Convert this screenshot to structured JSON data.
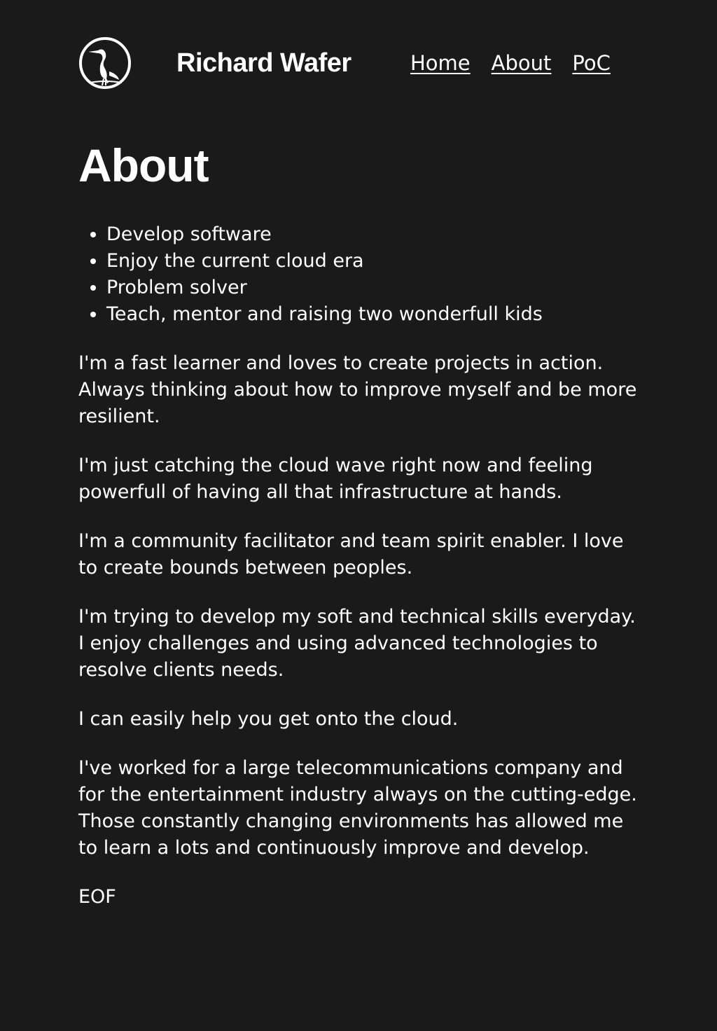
{
  "header": {
    "logo_icon": "heron-logo-icon",
    "site_title": "Richard Wafer",
    "nav": [
      {
        "label": "Home"
      },
      {
        "label": "About"
      },
      {
        "label": "PoC"
      }
    ]
  },
  "main": {
    "title": "About",
    "bullets": [
      "Develop software",
      "Enjoy the current cloud era",
      "Problem solver",
      "Teach, mentor and raising two wonderfull kids"
    ],
    "paragraphs": [
      "I'm a fast learner and loves to create projects in action. Always thinking about how to improve myself and be more resilient.",
      "I'm just catching the cloud wave right now and feeling powerfull of having all that infrastructure at hands.",
      "I'm a community facilitator and team spirit enabler. I love to create bounds between peoples.",
      "I'm trying to develop my soft and technical skills everyday. I enjoy challenges and using advanced technologies to resolve clients needs.",
      "I can easily help you get onto the cloud.",
      "I've worked for a large telecommunications company and for the entertainment industry always on the cutting-edge. Those constantly changing environments has allowed me to learn a lots and continuously improve and develop.",
      "EOF"
    ]
  },
  "colors": {
    "background": "#1a1a1a",
    "text": "#ffffff"
  }
}
